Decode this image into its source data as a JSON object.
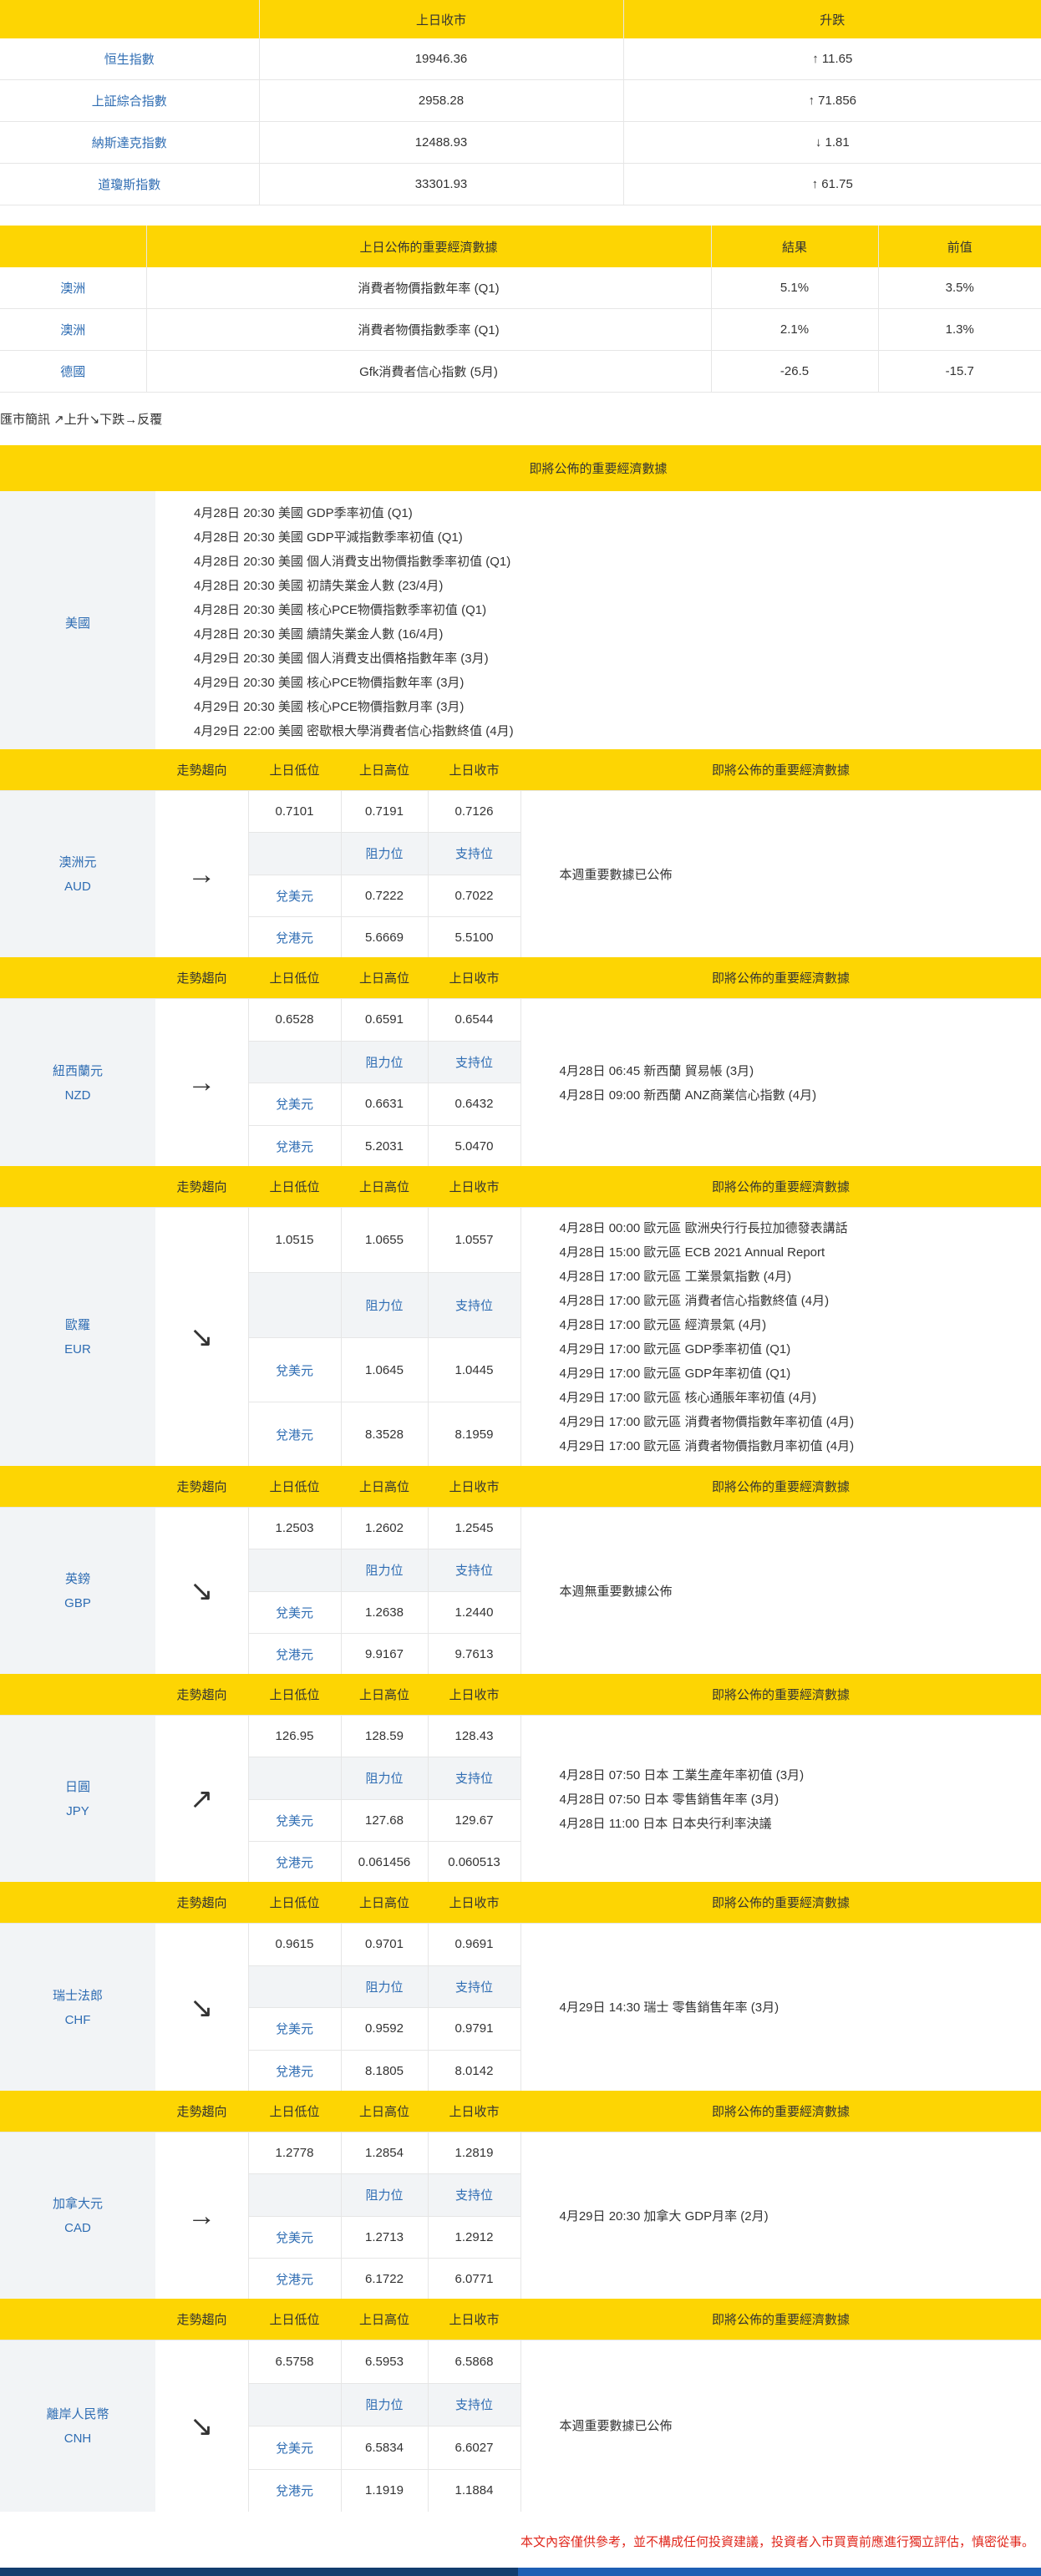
{
  "indices": {
    "headers": [
      "",
      "上日收市",
      "升跌"
    ],
    "rows": [
      {
        "name": "恒生指數",
        "close": "19946.36",
        "change": "↑ 11.65"
      },
      {
        "name": "上証綜合指數",
        "close": "2958.28",
        "change": "↑ 71.856"
      },
      {
        "name": "納斯達克指數",
        "close": "12488.93",
        "change": "↓ 1.81"
      },
      {
        "name": "道瓊斯指數",
        "close": "33301.93",
        "change": "↑ 61.75"
      }
    ]
  },
  "econ": {
    "headers": [
      "",
      "上日公佈的重要經濟數據",
      "結果",
      "前值"
    ],
    "rows": [
      {
        "region": "澳洲",
        "item": "消費者物價指數年率 (Q1)",
        "result": "5.1%",
        "prev": "3.5%"
      },
      {
        "region": "澳洲",
        "item": "消費者物價指數季率 (Q1)",
        "result": "2.1%",
        "prev": "1.3%"
      },
      {
        "region": "德國",
        "item": "Gfk消費者信心指數 (5月)",
        "result": "-26.5",
        "prev": "-15.7"
      }
    ]
  },
  "legend": "匯市簡訊 ↗上升↘下跌→反覆",
  "us": {
    "header": "即將公佈的重要經濟數據",
    "country": "美國",
    "events": [
      "4月28日 20:30  美國 GDP季率初值 (Q1)",
      "4月28日 20:30  美國 GDP平減指數季率初值 (Q1)",
      "4月28日 20:30  美國 個人消費支出物價指數季率初值 (Q1)",
      "4月28日 20:30  美國 初請失業金人數 (23/4月)",
      "4月28日 20:30  美國 核心PCE物價指數季率初值 (Q1)",
      "4月28日 20:30  美國 續請失業金人數 (16/4月)",
      "4月29日 20:30  美國 個人消費支出價格指數年率 (3月)",
      "4月29日 20:30  美國 核心PCE物價指數年率 (3月)",
      "4月29日 20:30  美國 核心PCE物價指數月率 (3月)",
      "4月29日 22:00  美國 密歇根大學消費者信心指數終值 (4月)"
    ]
  },
  "currency_headers": {
    "trend": "走勢趨向",
    "low": "上日低位",
    "high": "上日高位",
    "close": "上日收市",
    "events": "即將公佈的重要經濟數據",
    "resistance": "阻力位",
    "support": "支持位",
    "vs_usd": "兌美元",
    "vs_hkd": "兌港元"
  },
  "currencies": [
    {
      "name": "澳洲元",
      "code": "AUD",
      "arrow": "→",
      "low": "0.7101",
      "high": "0.7191",
      "close": "0.7126",
      "usd_res": "0.7222",
      "usd_sup": "0.7022",
      "hkd_res": "5.6669",
      "hkd_sup": "5.5100",
      "events": [
        "本週重要數據已公佈"
      ]
    },
    {
      "name": "紐西蘭元",
      "code": "NZD",
      "arrow": "→",
      "low": "0.6528",
      "high": "0.6591",
      "close": "0.6544",
      "usd_res": "0.6631",
      "usd_sup": "0.6432",
      "hkd_res": "5.2031",
      "hkd_sup": "5.0470",
      "events": [
        "4月28日 06:45  新西蘭 貿易帳 (3月)",
        "4月28日 09:00  新西蘭 ANZ商業信心指數 (4月)"
      ]
    },
    {
      "name": "歐羅",
      "code": "EUR",
      "arrow": "↘",
      "low": "1.0515",
      "high": "1.0655",
      "close": "1.0557",
      "usd_res": "1.0645",
      "usd_sup": "1.0445",
      "hkd_res": "8.3528",
      "hkd_sup": "8.1959",
      "events": [
        "4月28日 00:00  歐元區 歐洲央行行長拉加德發表講話",
        "4月28日 15:00  歐元區 ECB 2021 Annual Report",
        "4月28日 17:00  歐元區 工業景氣指數 (4月)",
        "4月28日 17:00  歐元區 消費者信心指數終值 (4月)",
        "4月28日 17:00  歐元區 經濟景氣 (4月)",
        "4月29日 17:00  歐元區 GDP季率初值 (Q1)",
        "4月29日 17:00  歐元區 GDP年率初值 (Q1)",
        "4月29日 17:00  歐元區 核心通脹年率初值 (4月)",
        "4月29日 17:00  歐元區 消費者物價指數年率初值 (4月)",
        "4月29日 17:00  歐元區 消費者物價指數月率初值 (4月)"
      ]
    },
    {
      "name": "英鎊",
      "code": "GBP",
      "arrow": "↘",
      "low": "1.2503",
      "high": "1.2602",
      "close": "1.2545",
      "usd_res": "1.2638",
      "usd_sup": "1.2440",
      "hkd_res": "9.9167",
      "hkd_sup": "9.7613",
      "events": [
        "本週無重要數據公佈"
      ]
    },
    {
      "name": "日圓",
      "code": "JPY",
      "arrow": "↗",
      "low": "126.95",
      "high": "128.59",
      "close": "128.43",
      "usd_res": "127.68",
      "usd_sup": "129.67",
      "hkd_res": "0.061456",
      "hkd_sup": "0.060513",
      "events": [
        "4月28日 07:50  日本 工業生產年率初值 (3月)",
        "4月28日 07:50  日本 零售銷售年率 (3月)",
        "4月28日 11:00  日本 日本央行利率決議"
      ]
    },
    {
      "name": "瑞士法郎",
      "code": "CHF",
      "arrow": "↘",
      "low": "0.9615",
      "high": "0.9701",
      "close": "0.9691",
      "usd_res": "0.9592",
      "usd_sup": "0.9791",
      "hkd_res": "8.1805",
      "hkd_sup": "8.0142",
      "events": [
        "4月29日 14:30  瑞士 零售銷售年率 (3月)"
      ]
    },
    {
      "name": "加拿大元",
      "code": "CAD",
      "arrow": "→",
      "low": "1.2778",
      "high": "1.2854",
      "close": "1.2819",
      "usd_res": "1.2713",
      "usd_sup": "1.2912",
      "hkd_res": "6.1722",
      "hkd_sup": "6.0771",
      "events": [
        "4月29日 20:30  加拿大 GDP月率 (2月)"
      ]
    },
    {
      "name": "離岸人民幣",
      "code": "CNH",
      "arrow": "↘",
      "low": "6.5758",
      "high": "6.5953",
      "close": "6.5868",
      "usd_res": "6.5834",
      "usd_sup": "6.6027",
      "hkd_res": "1.1919",
      "hkd_sup": "1.1884",
      "events": [
        "本週重要數據已公佈"
      ]
    }
  ],
  "disclaimer": "本文內容僅供參考，並不構成任何投資建議，投資者入市買賣前應進行獨立評估，慎密從事。"
}
